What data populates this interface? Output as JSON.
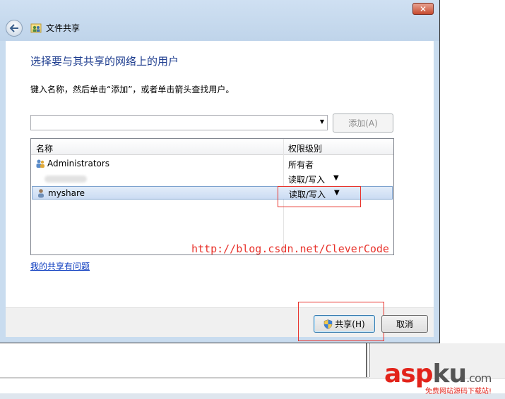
{
  "window": {
    "title": "文件共享",
    "close_label": "✕"
  },
  "main": {
    "heading": "选择要与其共享的网络上的用户",
    "instruction": "键入名称，然后单击“添加”，或者单击箭头查找用户。",
    "user_input": {
      "value": "",
      "placeholder": ""
    },
    "add_button": "添加(A)"
  },
  "table": {
    "columns": [
      "名称",
      "权限级别"
    ],
    "rows": [
      {
        "name": "Administrators",
        "permission": "所有者",
        "has_dropdown": false,
        "selected": false
      },
      {
        "name": "",
        "permission": "读取/写入",
        "has_dropdown": true,
        "selected": false
      },
      {
        "name": "myshare",
        "permission": "读取/写入",
        "has_dropdown": true,
        "selected": true
      }
    ],
    "dropdown_glyph": "▼"
  },
  "watermark_url": "http://blog.csdn.net/CleverCode",
  "problem_link": "我的共享有问题",
  "footer": {
    "share_button": "共享(H)",
    "cancel_button": "取消"
  },
  "logo": {
    "part1": "asp",
    "part2": "ku",
    "suffix": ".com",
    "tagline": "免费网站源码下载站!"
  },
  "colors": {
    "heading": "#1e3d8f",
    "link": "#0b3bbf",
    "annotation_red": "#e8332c",
    "dialog_frame": "#c9dcef"
  }
}
